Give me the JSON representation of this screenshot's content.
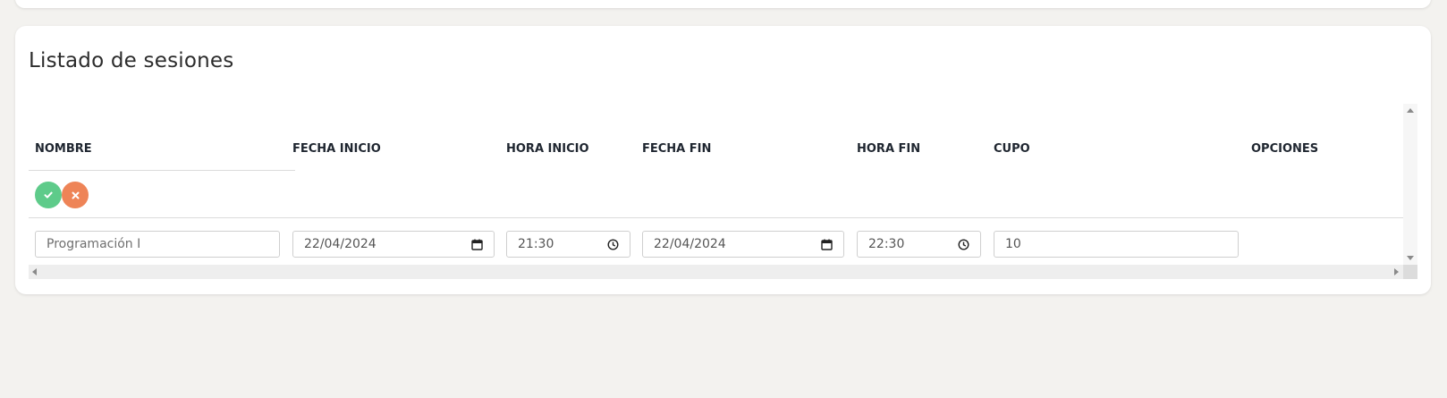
{
  "section": {
    "title": "Listado de sesiones"
  },
  "table": {
    "headers": {
      "nombre": "NOMBRE",
      "fecha_inicio": "FECHA INICIO",
      "hora_inicio": "HORA INICIO",
      "fecha_fin": "FECHA FIN",
      "hora_fin": "HORA FIN",
      "cupo": "CUPO",
      "opciones": "OPCIONES"
    },
    "actions": {
      "confirm_icon": "check-icon",
      "cancel_icon": "x-icon",
      "confirm_color": "#5ecb8a",
      "cancel_color": "#ee8457"
    },
    "row": {
      "nombre_placeholder": "Programación I",
      "fecha_inicio": "22/04/2024",
      "hora_inicio": "21:30",
      "fecha_fin": "22/04/2024",
      "hora_fin": "22:30",
      "cupo": "10"
    }
  },
  "icons": {
    "date": "calendar-icon",
    "time": "clock-icon"
  }
}
